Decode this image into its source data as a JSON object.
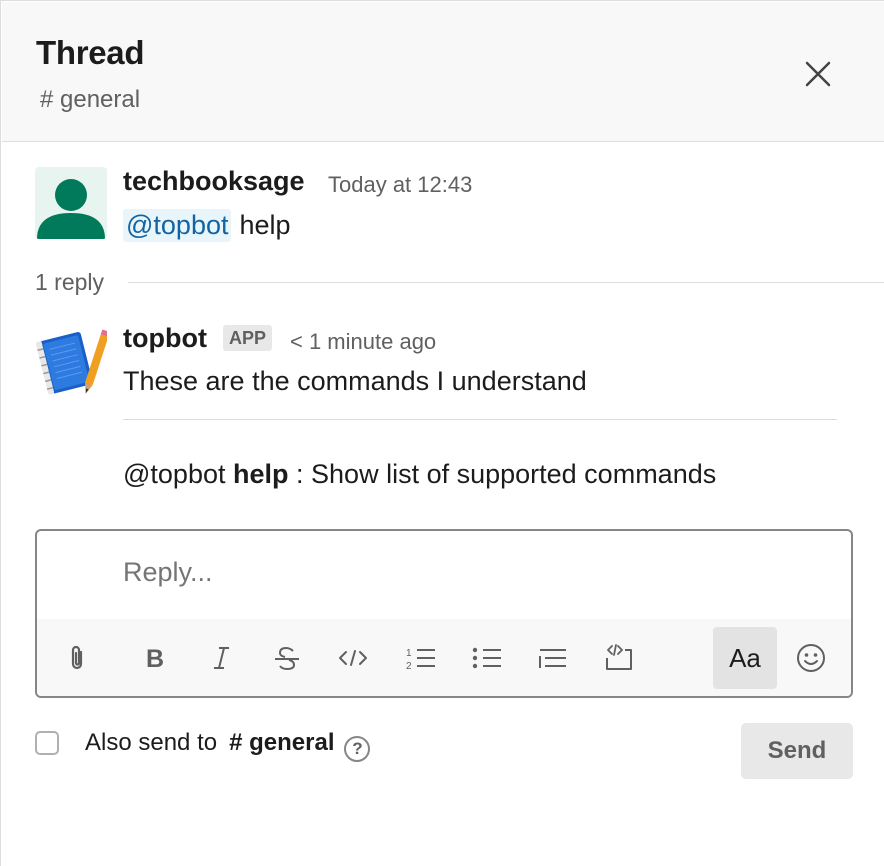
{
  "header": {
    "title": "Thread",
    "channel": "# general"
  },
  "parent_message": {
    "author": "techbooksage",
    "timestamp": "Today at 12:43",
    "mention": "@topbot",
    "text": "help"
  },
  "replies": {
    "count_label": "1 reply"
  },
  "bot_message": {
    "author": "topbot",
    "badge": "APP",
    "timestamp": "< 1 minute ago",
    "text": "These are the commands I understand",
    "command_prefix": "@topbot",
    "command_name": "help",
    "command_desc": ": Show list of supported commands"
  },
  "composer": {
    "placeholder": "Reply...",
    "toolbar": {
      "attach_icon": "paperclip-icon",
      "bold_icon": "bold-icon",
      "italic_icon": "italic-icon",
      "strike_icon": "strikethrough-icon",
      "code_icon": "code-icon",
      "ordered_list_icon": "numbered-list-icon",
      "bullet_list_icon": "bulleted-list-icon",
      "quote_icon": "blockquote-icon",
      "code_block_icon": "code-block-icon",
      "format_label": "Aa",
      "emoji_icon": "emoji-icon"
    }
  },
  "footer": {
    "also_send_label": "Also send to",
    "also_send_channel": "# general",
    "help_glyph": "?",
    "send_label": "Send"
  },
  "colors": {
    "mention_bg": "#e8f5fa",
    "mention_text": "#1264a3",
    "user_avatar": "#007a5a",
    "header_bg": "#f8f8f8"
  }
}
